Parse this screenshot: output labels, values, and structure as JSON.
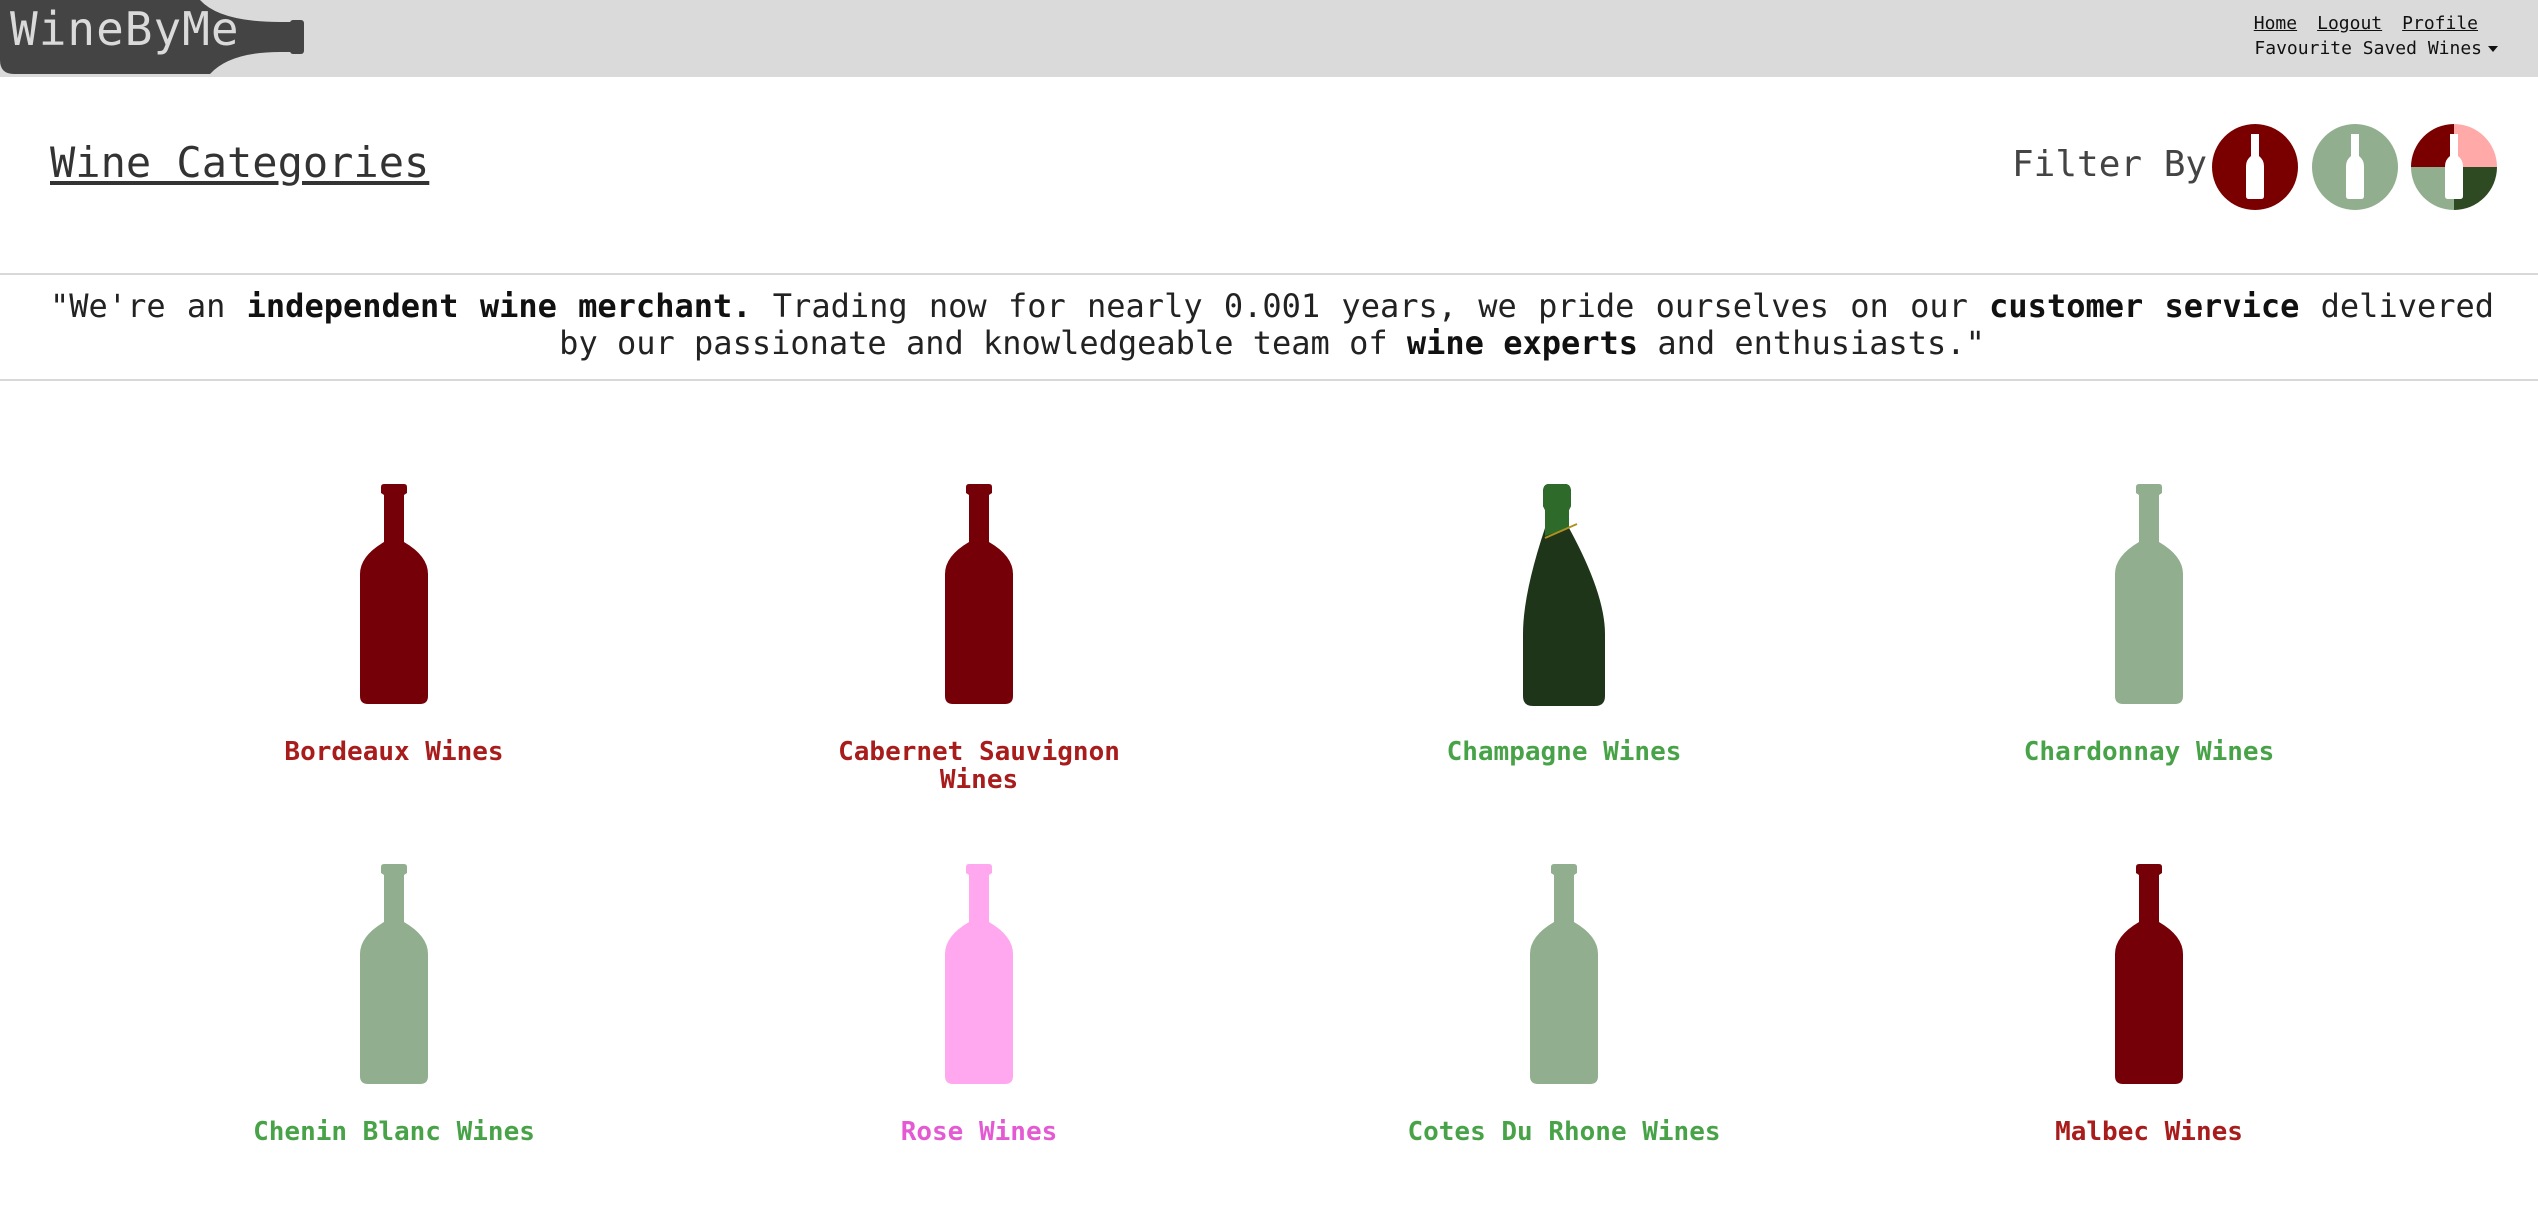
{
  "brand": {
    "logo_text": "WineByMe"
  },
  "nav": {
    "home": "Home",
    "logout": "Logout",
    "profile": "Profile",
    "favourites_dropdown": "Favourite Saved Wines"
  },
  "header": {
    "title": "Wine Categories",
    "filter_label": "Filter By."
  },
  "filters": [
    {
      "name": "red",
      "icon": "red-wine-bottle-icon",
      "color": "#7a0000"
    },
    {
      "name": "white",
      "icon": "white-wine-bottle-icon",
      "color": "#91ae8e"
    },
    {
      "name": "all",
      "icon": "mixed-wine-bottle-icon",
      "colors": [
        "#7a0000",
        "#ffaaa8",
        "#91ae8e",
        "#2e4a22"
      ]
    }
  ],
  "quote": {
    "p1": "\"We're an ",
    "b1": "independent wine merchant.",
    "p2": " Trading now for nearly 0.001 years, we pride ourselves on our ",
    "b2": "customer service",
    "p3": " delivered by our passionate and knowledgeable team of ",
    "b3": "wine experts",
    "p4": " and enthusiasts.\""
  },
  "categories": [
    {
      "label": "Bordeaux Wines",
      "type": "red",
      "bottle_color": "#760007",
      "label_color": "#a81c1c"
    },
    {
      "label": "Cabernet Sauvignon Wines",
      "type": "red",
      "bottle_color": "#760007",
      "label_color": "#a81c1c"
    },
    {
      "label": "Champagne Wines",
      "type": "sparkling",
      "bottle_color": "#1f351a",
      "label_color": "#48a348"
    },
    {
      "label": "Chardonnay Wines",
      "type": "white",
      "bottle_color": "#91ae8e",
      "label_color": "#48a348"
    },
    {
      "label": "Chenin Blanc Wines",
      "type": "white",
      "bottle_color": "#91ae8e",
      "label_color": "#48a348"
    },
    {
      "label": "Rose Wines",
      "type": "rose",
      "bottle_color": "#ffa8ef",
      "label_color": "#e35ad3"
    },
    {
      "label": "Cotes Du Rhone Wines",
      "type": "white",
      "bottle_color": "#91ae8e",
      "label_color": "#48a348"
    },
    {
      "label": "Malbec Wines",
      "type": "red",
      "bottle_color": "#760007",
      "label_color": "#a81c1c"
    }
  ]
}
